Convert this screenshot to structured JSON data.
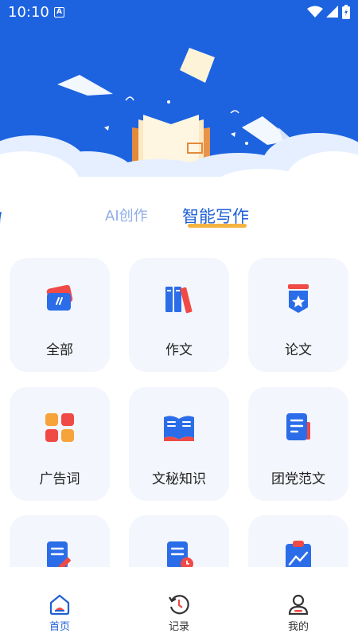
{
  "status_bar": {
    "time": "10:10",
    "icons": [
      "a-icon",
      "wifi-icon",
      "signal-icon",
      "battery-icon"
    ]
  },
  "tabs": [
    {
      "label": "AI创作",
      "active": false
    },
    {
      "label": "智能写作",
      "active": true
    }
  ],
  "cards": [
    {
      "label": "全部",
      "icon": "cards-icon"
    },
    {
      "label": "作文",
      "icon": "books-icon"
    },
    {
      "label": "论文",
      "icon": "badge-star-icon"
    },
    {
      "label": "广告词",
      "icon": "grid-blocks-icon"
    },
    {
      "label": "文秘知识",
      "icon": "open-book-icon"
    },
    {
      "label": "团党范文",
      "icon": "document-icon"
    },
    {
      "label": "",
      "icon": "edit-document-icon"
    },
    {
      "label": "",
      "icon": "document-clock-icon"
    },
    {
      "label": "",
      "icon": "clipboard-chart-icon"
    }
  ],
  "bottom_nav": [
    {
      "label": "首页",
      "icon": "home-icon",
      "active": true
    },
    {
      "label": "记录",
      "icon": "history-icon",
      "active": false
    },
    {
      "label": "我的",
      "icon": "user-icon",
      "active": false
    }
  ],
  "colors": {
    "primary": "#1f5fd6",
    "hero": "#1d63e0",
    "accent": "#f5b342",
    "card_bg": "#f3f6fc",
    "red": "#f04a46"
  }
}
